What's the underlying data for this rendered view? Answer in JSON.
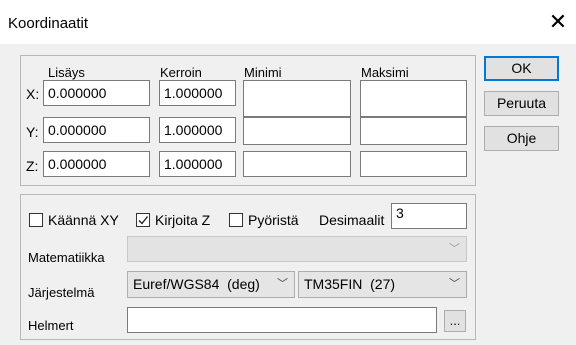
{
  "dialog": {
    "title": "Koordinaatit",
    "close_glyph": "✕"
  },
  "coords": {
    "headers": {
      "offset": "Lisäys",
      "factor": "Kerroin",
      "min": "Minimi",
      "max": "Maksimi"
    },
    "rows": [
      {
        "axis": "X:",
        "offset": "0.000000",
        "factor": "1.000000",
        "min": "",
        "max": ""
      },
      {
        "axis": "Y:",
        "offset": "0.000000",
        "factor": "1.000000",
        "min": "",
        "max": ""
      },
      {
        "axis": "Z:",
        "offset": "0.000000",
        "factor": "1.000000",
        "min": "",
        "max": ""
      }
    ]
  },
  "options": {
    "swap_xy": {
      "label": "Käännä XY",
      "checked": false
    },
    "write_z": {
      "label": "Kirjoita Z",
      "checked": true
    },
    "round": {
      "label": "Pyöristä",
      "checked": false
    },
    "decimals_label": "Desimaalit",
    "decimals_value": "3",
    "math_label": "Matematiikka",
    "math_value": "",
    "system_label": "Järjestelmä",
    "datum_value": "Euref/WGS84  (deg)",
    "projection_value": "TM35FIN  (27)",
    "helmert_label": "Helmert",
    "helmert_value": "",
    "browse_label": "..."
  },
  "buttons": {
    "ok": "OK",
    "cancel": "Peruuta",
    "help": "Ohje"
  },
  "icons": {
    "checkmark": "check-icon",
    "dropdown": "chevron-down-icon",
    "close": "close-icon"
  }
}
